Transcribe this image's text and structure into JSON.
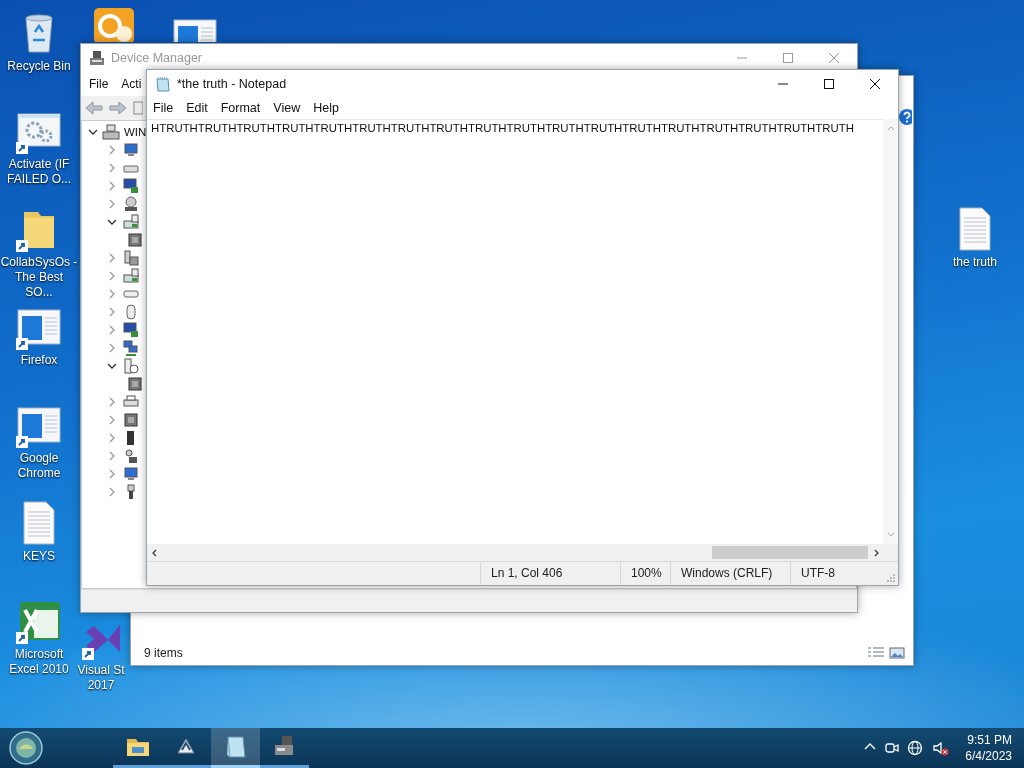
{
  "desktop": {
    "left_icons": [
      {
        "kind": "recycle-bin",
        "label": "Recycle Bin",
        "shortcut": false
      },
      {
        "kind": "gear-window",
        "label": "Activate (IF\nFAILED O...",
        "shortcut": true
      },
      {
        "kind": "folder",
        "label": "CollabSysOs -\nThe Best SO...",
        "shortcut": true
      },
      {
        "kind": "app-window",
        "label": "Firefox",
        "shortcut": true
      },
      {
        "kind": "app-window",
        "label": "Google\nChrome",
        "shortcut": true
      },
      {
        "kind": "text-file",
        "label": "KEYS",
        "shortcut": false
      },
      {
        "kind": "spreadsheet",
        "label": "Microsoft\nExcel 2010",
        "shortcut": true
      }
    ],
    "top_icons": [
      {
        "kind": "mail-clock",
        "shortcut": false
      },
      {
        "kind": "app-window",
        "shortcut": false
      }
    ],
    "bottom_icons": [
      {
        "kind": "infinity-logo",
        "label": "Visual St\n2017",
        "shortcut": true
      }
    ],
    "right_icons": [
      {
        "kind": "text-file",
        "label": "the truth",
        "shortcut": false
      }
    ]
  },
  "explorer_window": {
    "status": "9 items"
  },
  "device_manager": {
    "title": "Device Manager",
    "menu": [
      "File",
      "Acti"
    ],
    "tree": {
      "label": "WIN",
      "expanded": true,
      "children": [
        {
          "kind": "computer",
          "expanded": false
        },
        {
          "kind": "drive",
          "expanded": false
        },
        {
          "kind": "display",
          "expanded": false
        },
        {
          "kind": "disc",
          "expanded": false
        },
        {
          "kind": "controller",
          "expanded": true,
          "children": [
            {
              "kind": "chip"
            }
          ]
        },
        {
          "kind": "hid",
          "expanded": false
        },
        {
          "kind": "controller",
          "expanded": false
        },
        {
          "kind": "keyboard",
          "expanded": false
        },
        {
          "kind": "mouse",
          "expanded": false
        },
        {
          "kind": "display",
          "expanded": false
        },
        {
          "kind": "network",
          "expanded": false
        },
        {
          "kind": "unknown",
          "expanded": true,
          "children": [
            {
              "kind": "chip"
            }
          ]
        },
        {
          "kind": "printer",
          "expanded": false
        },
        {
          "kind": "chip",
          "expanded": false
        },
        {
          "kind": "tower",
          "expanded": false
        },
        {
          "kind": "sound",
          "expanded": false
        },
        {
          "kind": "computer",
          "expanded": false
        },
        {
          "kind": "usb",
          "expanded": false
        }
      ]
    }
  },
  "notepad": {
    "title": "*the truth - Notepad",
    "menu": [
      "File",
      "Edit",
      "Format",
      "View",
      "Help"
    ],
    "text": "HTRUTHTRUTHTRUTHTRUTHTRUTHTRUTHTRUTHTRUTHTRUTHTRUTHTRUTHTRUTHTRUTHTRUTHTRUTHTRUTHTRUTHTRUTH",
    "status_bar": [
      "Ln 1, Col 406",
      "100%",
      "Windows (CRLF)",
      "UTF-8"
    ]
  },
  "taskbar": {
    "apps": [
      {
        "kind": "folder",
        "selected": false
      },
      {
        "kind": "app",
        "selected": false
      },
      {
        "kind": "notepad",
        "selected": true
      },
      {
        "kind": "device-manager",
        "selected": false
      }
    ],
    "time": "9:51 PM",
    "date": "6/4/2023",
    "tray": [
      {
        "kind": "chevron"
      },
      {
        "kind": "meet"
      },
      {
        "kind": "globe"
      },
      {
        "kind": "speaker-muted"
      }
    ]
  }
}
